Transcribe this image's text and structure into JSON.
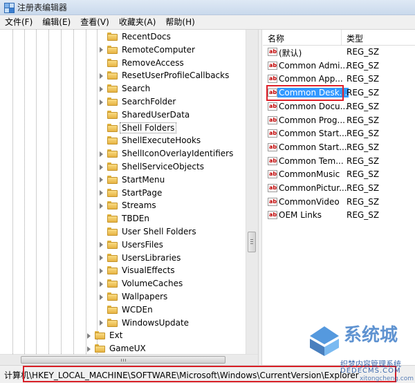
{
  "window": {
    "title": "注册表编辑器"
  },
  "menu": [
    {
      "label": "文件(F)"
    },
    {
      "label": "编辑(E)"
    },
    {
      "label": "查看(V)"
    },
    {
      "label": "收藏夹(A)"
    },
    {
      "label": "帮助(H)"
    }
  ],
  "tree": {
    "items": [
      {
        "label": "RecentDocs",
        "expandable": false
      },
      {
        "label": "RemoteComputer",
        "expandable": true
      },
      {
        "label": "RemoveAccess",
        "expandable": false
      },
      {
        "label": "ResetUserProfileCallbacks",
        "expandable": true
      },
      {
        "label": "Search",
        "expandable": true
      },
      {
        "label": "SearchFolder",
        "expandable": true
      },
      {
        "label": "SharedUserData",
        "expandable": false
      },
      {
        "label": "Shell Folders",
        "expandable": false,
        "selected": true
      },
      {
        "label": "ShellExecuteHooks",
        "expandable": false
      },
      {
        "label": "ShellIconOverlayIdentifiers",
        "expandable": true
      },
      {
        "label": "ShellServiceObjects",
        "expandable": true
      },
      {
        "label": "StartMenu",
        "expandable": true
      },
      {
        "label": "StartPage",
        "expandable": true
      },
      {
        "label": "Streams",
        "expandable": true
      },
      {
        "label": "TBDEn",
        "expandable": false
      },
      {
        "label": "User Shell Folders",
        "expandable": false
      },
      {
        "label": "UsersFiles",
        "expandable": true
      },
      {
        "label": "UsersLibraries",
        "expandable": true
      },
      {
        "label": "VisualEffects",
        "expandable": true
      },
      {
        "label": "VolumeCaches",
        "expandable": true
      },
      {
        "label": "Wallpapers",
        "expandable": true
      },
      {
        "label": "WCDEn",
        "expandable": false
      },
      {
        "label": "WindowsUpdate",
        "expandable": true
      },
      {
        "label": "Ext",
        "expandable": true,
        "level": 1
      },
      {
        "label": "GameUX",
        "expandable": true,
        "level": 1
      }
    ]
  },
  "list": {
    "columns": {
      "name": "名称",
      "type": "类型"
    },
    "rows": [
      {
        "name": "(默认)",
        "type": "REG_SZ"
      },
      {
        "name": "Common Admi...",
        "type": "REG_SZ"
      },
      {
        "name": "Common App...",
        "type": "REG_SZ"
      },
      {
        "name": "Common Desk...",
        "type": "REG_SZ",
        "selected": true
      },
      {
        "name": "Common Docu...",
        "type": "REG_SZ"
      },
      {
        "name": "Common Prog...",
        "type": "REG_SZ"
      },
      {
        "name": "Common Start...",
        "type": "REG_SZ"
      },
      {
        "name": "Common Start...",
        "type": "REG_SZ"
      },
      {
        "name": "Common Tem...",
        "type": "REG_SZ"
      },
      {
        "name": "CommonMusic",
        "type": "REG_SZ"
      },
      {
        "name": "CommonPictur...",
        "type": "REG_SZ"
      },
      {
        "name": "CommonVideo",
        "type": "REG_SZ"
      },
      {
        "name": "OEM Links",
        "type": "REG_SZ"
      }
    ],
    "icon_text": "ab"
  },
  "status": {
    "path": "计算机\\HKEY_LOCAL_MACHINE\\SOFTWARE\\Microsoft\\Windows\\CurrentVersion\\Explorer"
  },
  "watermark": {
    "brand": "系统城",
    "line1": "织梦内容管理系统",
    "line2": "DEDECMS.COM",
    "line3": "xitongcheng.com"
  },
  "colors": {
    "selection": "#3399ff",
    "highlight_box": "#e0202a",
    "titlebar": "#dfe9f5"
  }
}
